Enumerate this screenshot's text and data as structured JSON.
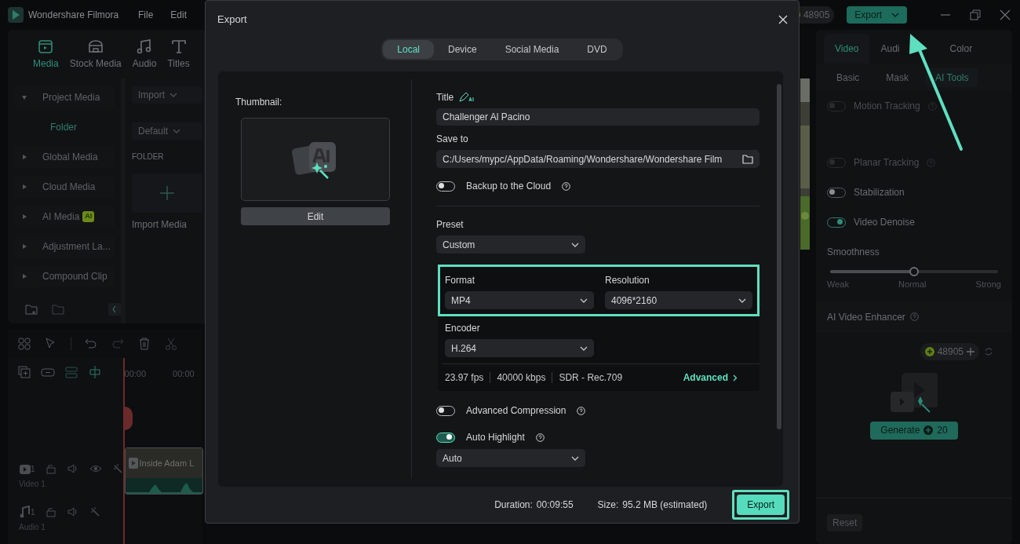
{
  "app": {
    "title": "Wondershare Filmora",
    "menu": [
      "File",
      "Edit"
    ],
    "credits": "48905",
    "export_button": "Export"
  },
  "media_tabs": [
    {
      "label": "Media",
      "selected": true
    },
    {
      "label": "Stock Media",
      "selected": false
    },
    {
      "label": "Audio",
      "selected": false
    },
    {
      "label": "Titles",
      "selected": false
    }
  ],
  "media_sidebar": [
    {
      "label": "Project Media",
      "expanded": true,
      "children": [
        {
          "label": "Folder",
          "selected": true
        }
      ]
    },
    {
      "label": "Global Media",
      "expanded": false
    },
    {
      "label": "Cloud Media",
      "expanded": false
    },
    {
      "label": "AI Media",
      "expanded": false,
      "badge": "AI"
    },
    {
      "label": "Adjustment La...",
      "expanded": false
    },
    {
      "label": "Compound Clip",
      "expanded": false
    }
  ],
  "media_browser": {
    "import": "Import",
    "sort": "Default",
    "section": "FOLDER",
    "tile": "Import Media"
  },
  "timeline": {
    "ruler": [
      "00:00",
      "00:00"
    ],
    "tracks": [
      {
        "kind": "video",
        "number": "1",
        "name": "Video 1",
        "clip": "Inside Adam L"
      },
      {
        "kind": "audio",
        "number": "1",
        "name": "Audio 1"
      }
    ]
  },
  "properties": {
    "tabs": [
      {
        "label": "Video",
        "selected": true
      },
      {
        "label": "Audi",
        "selected": false
      },
      {
        "label": "Color",
        "selected": false
      }
    ],
    "subtabs": [
      {
        "label": "Basic",
        "selected": false
      },
      {
        "label": "Mask",
        "selected": false
      },
      {
        "label": "AI Tools",
        "selected": true
      }
    ],
    "features": [
      {
        "label": "Motion Tracking",
        "on": false,
        "disabled": true
      },
      {
        "label": "Planar Tracking",
        "on": false,
        "disabled": true
      },
      {
        "label": "Stabilization",
        "on": false,
        "disabled": false
      },
      {
        "label": "Video Denoise",
        "on": true,
        "disabled": false
      }
    ],
    "smoothness": {
      "label": "Smoothness",
      "level": 0.5,
      "ticks": [
        "Weak",
        "Normal",
        "Strong"
      ]
    },
    "enhancer": {
      "title": "AI Video Enhancer",
      "credits": "48905",
      "generate": "Generate",
      "cost": "20"
    },
    "reset": "Reset"
  },
  "dialog": {
    "title": "Export",
    "tabs": [
      {
        "label": "Local",
        "selected": true
      },
      {
        "label": "Device",
        "selected": false
      },
      {
        "label": "Social Media",
        "selected": false
      },
      {
        "label": "DVD",
        "selected": false
      }
    ],
    "thumbnail_label": "Thumbnail:",
    "edit": "Edit",
    "title_label": "Title",
    "title_value": "Challenger Al Pacino",
    "save_label": "Save to",
    "save_path": "C:/Users/mypc/AppData/Roaming/Wondershare/Wondershare Film",
    "backup": {
      "label": "Backup to the Cloud",
      "on": false
    },
    "preset": {
      "label": "Preset",
      "value": "Custom"
    },
    "format": {
      "label": "Format",
      "value": "MP4"
    },
    "resolution": {
      "label": "Resolution",
      "value": "4096*2160"
    },
    "format_highlighted": true,
    "encoder": {
      "label": "Encoder",
      "value": "H.264"
    },
    "specs": [
      "23.97 fps",
      "40000 kbps",
      "SDR - Rec.709"
    ],
    "advanced": "Advanced",
    "compression": {
      "label": "Advanced Compression",
      "on": false
    },
    "highlight": {
      "label": "Auto Highlight",
      "on": true,
      "value": "Auto"
    },
    "duration_label": "Duration:",
    "duration": "00:09:55",
    "size_label": "Size:",
    "size": "95.2 MB (estimated)",
    "export": "Export",
    "export_highlighted": true
  }
}
